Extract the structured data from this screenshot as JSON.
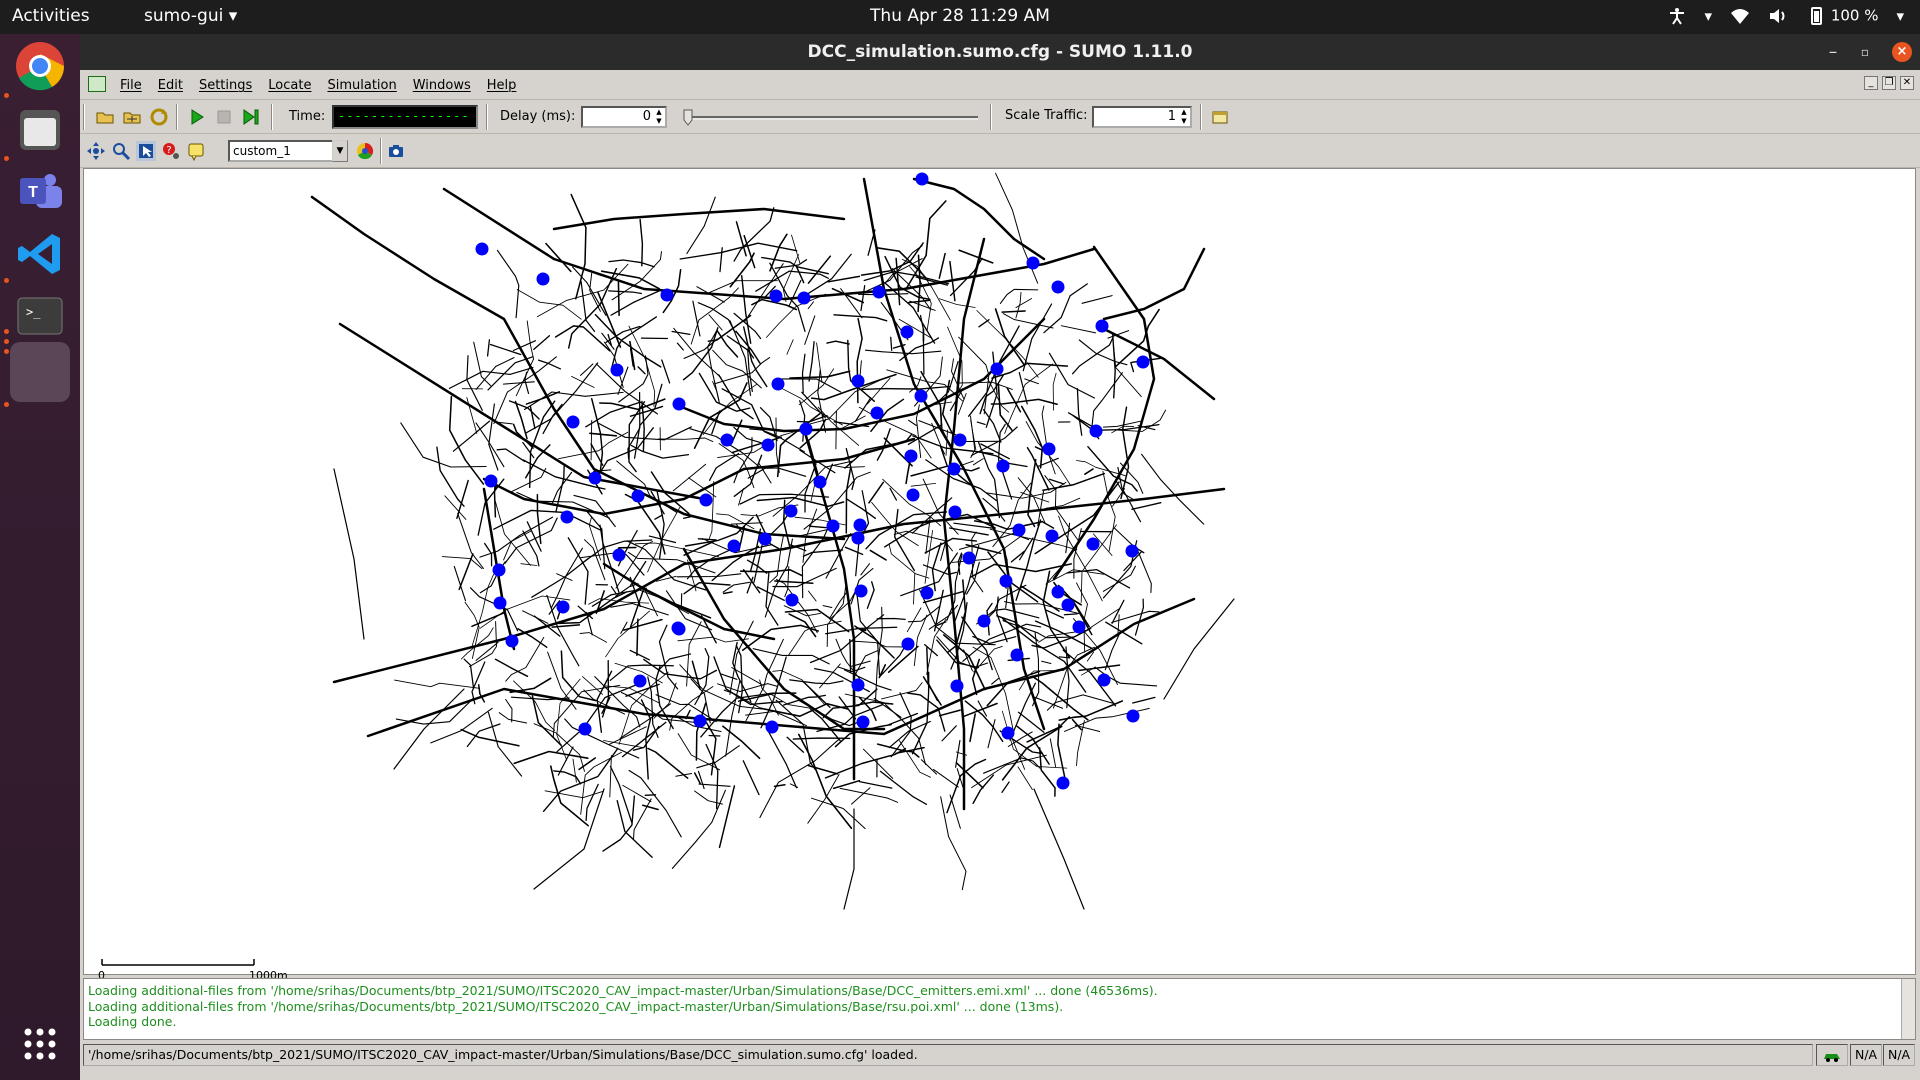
{
  "topbar": {
    "activities": "Activities",
    "app_name": "sumo-gui",
    "clock": "Thu Apr 28  11:29 AM",
    "battery": "100 %"
  },
  "window": {
    "title": "DCC_simulation.sumo.cfg - SUMO 1.11.0"
  },
  "menu": [
    "File",
    "Edit",
    "Settings",
    "Locate",
    "Simulation",
    "Windows",
    "Help"
  ],
  "toolbar": {
    "time_label": "Time:",
    "time_value": "-----------------",
    "delay_label": "Delay (ms):",
    "delay_value": "0",
    "scale_label": "Scale Traffic:",
    "scale_value": "1"
  },
  "view_toolbar": {
    "scheme": "custom_1"
  },
  "canvas": {
    "scale_zero": "0",
    "scale_max": "1000m",
    "emitter_color": "#0000ff"
  },
  "messages": [
    "Loading additional-files from '/home/srihas/Documents/btp_2021/SUMO/ITSC2020_CAV_impact-master/Urban/Simulations/Base/DCC_emitters.emi.xml' ... done (46536ms).",
    "Loading additional-files from '/home/srihas/Documents/btp_2021/SUMO/ITSC2020_CAV_impact-master/Urban/Simulations/Base/rsu.poi.xml' ... done (13ms).",
    "Loading done."
  ],
  "status": {
    "text": "'/home/srihas/Documents/btp_2021/SUMO/ITSC2020_CAV_impact-master/Urban/Simulations/Base/DCC_simulation.sumo.cfg' loaded.",
    "na1": "N/A",
    "na2": "N/A"
  }
}
